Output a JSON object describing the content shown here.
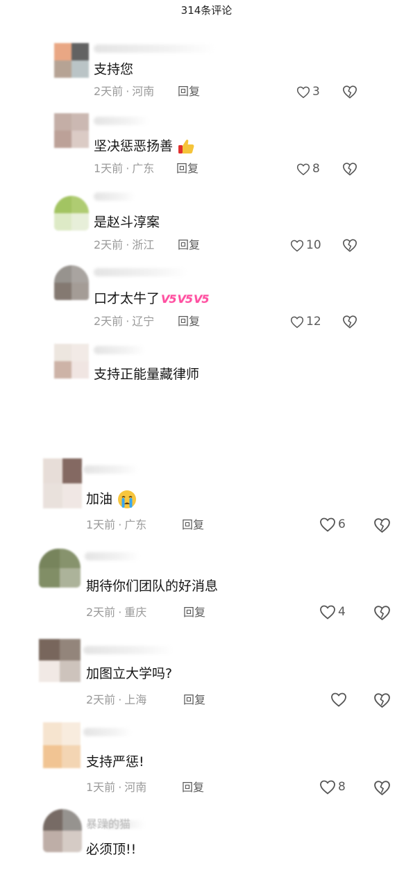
{
  "header": {
    "title": "314条评论"
  },
  "comments": [
    {
      "text": "支持您",
      "time": "2天前",
      "region": "河南",
      "reply": "回复",
      "likes": "3"
    },
    {
      "text": "坚决惩恶扬善",
      "emoji": "thumbs-up",
      "time": "1天前",
      "region": "广东",
      "reply": "回复",
      "likes": "8"
    },
    {
      "text": "是赵斗淳案",
      "time": "2天前",
      "region": "浙江",
      "reply": "回复",
      "likes": "10"
    },
    {
      "text": "口才太牛了",
      "badges": [
        "V5",
        "V5",
        "V5"
      ],
      "time": "2天前",
      "region": "辽宁",
      "reply": "回复",
      "likes": "12"
    },
    {
      "text": "支持正能量藏律师"
    },
    {
      "text": "加油",
      "emoji": "crying-face",
      "time": "1天前",
      "region": "广东",
      "reply": "回复",
      "likes": "6"
    },
    {
      "text": "期待你们团队的好消息",
      "time": "2天前",
      "region": "重庆",
      "reply": "回复",
      "likes": "4"
    },
    {
      "text": "加图立大学吗?",
      "time": "2天前",
      "region": "上海",
      "reply": "回复",
      "likes": ""
    },
    {
      "text": "支持严惩!",
      "time": "1天前",
      "region": "河南",
      "reply": "回复",
      "likes": "8"
    },
    {
      "text": "必须顶!!",
      "name": "暴躁的猫"
    }
  ],
  "icons": {
    "like": "heart-outline-icon",
    "dislike": "broken-heart-icon"
  },
  "colors": {
    "text": "#161616",
    "meta": "#9a9a9a",
    "reply": "#5a5a5a",
    "badge": "#ff4fa0",
    "background": "#ffffff"
  }
}
